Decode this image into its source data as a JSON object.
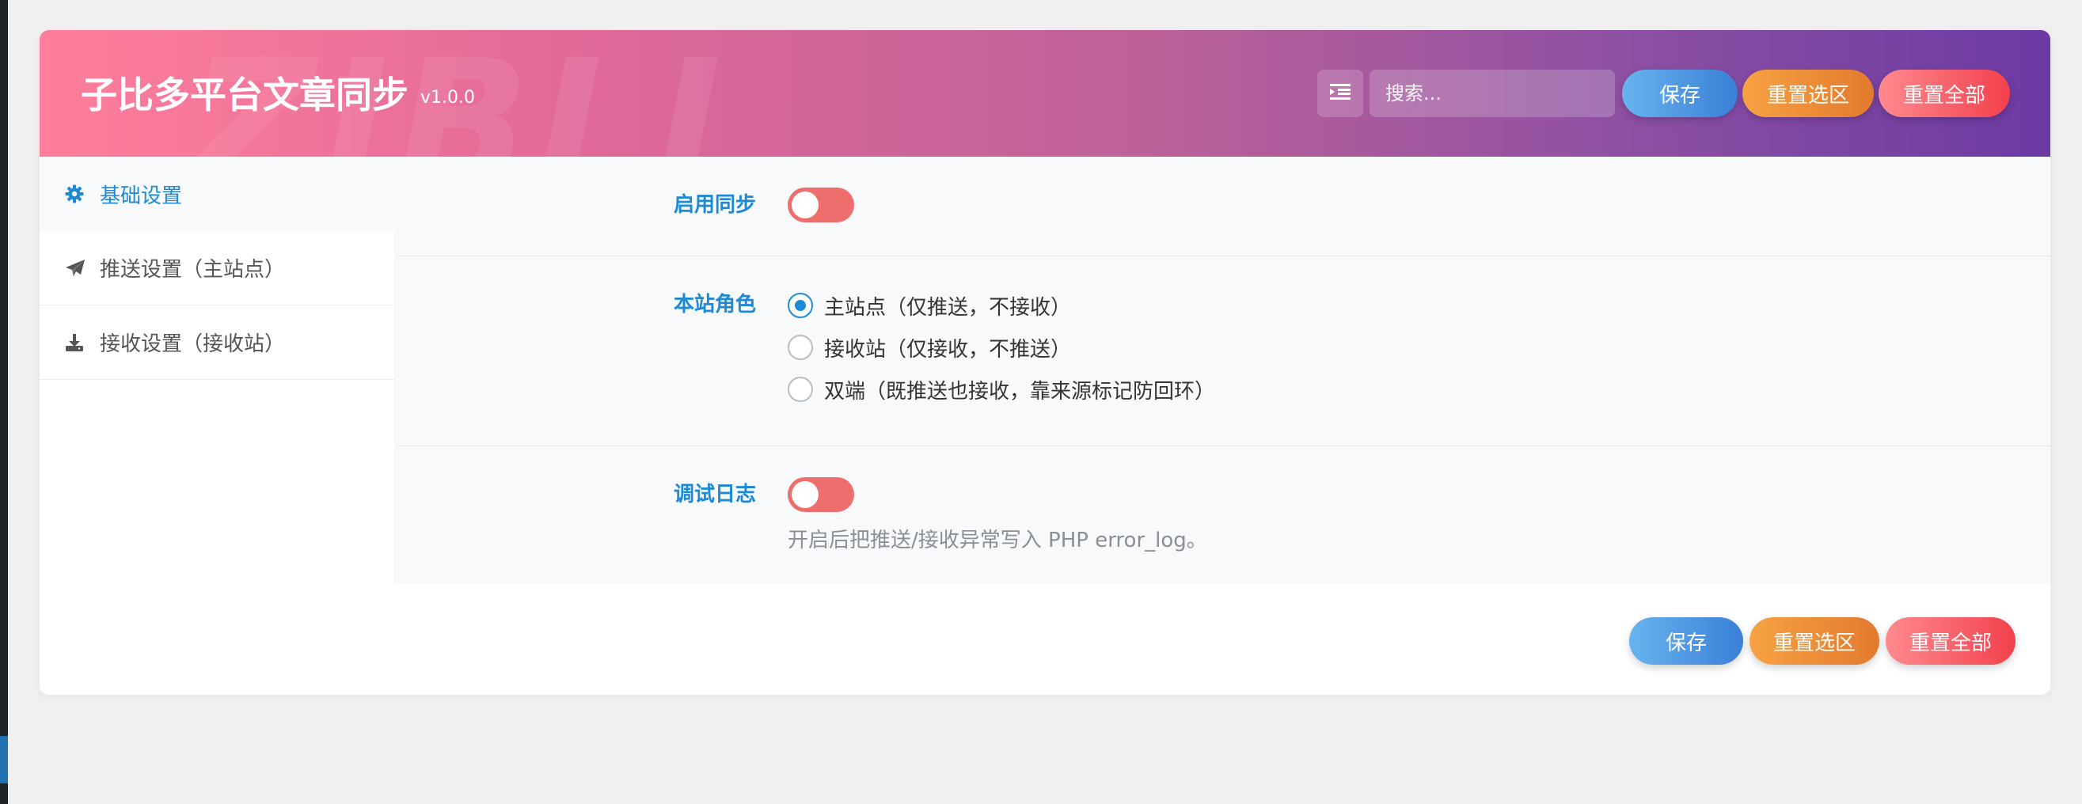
{
  "header": {
    "title": "子比多平台文章同步",
    "version": "v1.0.0",
    "watermark": "ZIBLL",
    "search_placeholder": "搜索...",
    "menu_icon": "list-indent-icon",
    "save_label": "保存",
    "reset_section_label": "重置选区",
    "reset_all_label": "重置全部"
  },
  "sidebar": {
    "items": [
      {
        "label": "基础设置",
        "icon": "gear-icon",
        "active": true
      },
      {
        "label": "推送设置（主站点）",
        "icon": "paper-plane-icon",
        "active": false
      },
      {
        "label": "接收设置（接收站）",
        "icon": "download-icon",
        "active": false
      }
    ]
  },
  "settings": {
    "enable_sync": {
      "label": "启用同步",
      "enabled": false
    },
    "site_role": {
      "label": "本站角色",
      "options": [
        {
          "label": "主站点（仅推送，不接收）",
          "checked": true
        },
        {
          "label": "接收站（仅接收，不推送）",
          "checked": false
        },
        {
          "label": "双端（既推送也接收，靠来源标记防回环）",
          "checked": false
        }
      ]
    },
    "debug_log": {
      "label": "调试日志",
      "enabled": false,
      "description": "开启后把推送/接收异常写入 PHP error_log。"
    }
  },
  "footer": {
    "save_label": "保存",
    "reset_section_label": "重置选区",
    "reset_all_label": "重置全部"
  },
  "colors": {
    "accent": "#1e8ad6",
    "switch_off": "#ee6e6e",
    "header_gradient_start": "#ff7e9b",
    "header_gradient_end": "#6b3aa3"
  }
}
